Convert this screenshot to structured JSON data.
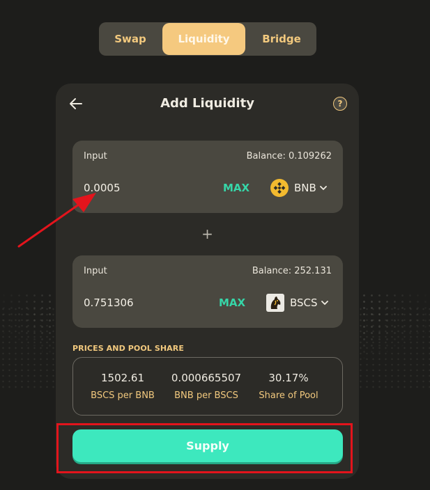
{
  "tabs": [
    {
      "label": "Swap",
      "active": false
    },
    {
      "label": "Liquidity",
      "active": true
    },
    {
      "label": "Bridge",
      "active": false
    }
  ],
  "card": {
    "title": "Add Liquidity",
    "back_icon": "arrow-left-icon",
    "help_icon": "question-circle-icon",
    "help_glyph": "?"
  },
  "input_a": {
    "label": "Input",
    "balance": "Balance: 0.109262",
    "value": "0.0005",
    "max_label": "MAX",
    "token": "BNB",
    "token_icon": "bnb-logo-icon"
  },
  "plus": "+",
  "input_b": {
    "label": "Input",
    "balance": "Balance: 252.131",
    "value": "0.751306",
    "max_label": "MAX",
    "token": "BSCS",
    "token_icon": "bscs-logo-icon"
  },
  "pool": {
    "heading": "PRICES AND POOL SHARE",
    "stats": [
      {
        "value": "1502.61",
        "label": "BSCS per BNB"
      },
      {
        "value": "0.000665507",
        "label": "BNB per BSCS"
      },
      {
        "value": "30.17%",
        "label": "Share of Pool"
      }
    ]
  },
  "supply_label": "Supply",
  "colors": {
    "background": "#1d1d1b",
    "card": "#2c2b27",
    "panel": "#4a4840",
    "accent_gold": "#f2c97e",
    "active_tab": "#f5c97f",
    "max_green": "#36d6a8",
    "supply_button": "#3de8be",
    "annotation_red": "#e3141c"
  }
}
